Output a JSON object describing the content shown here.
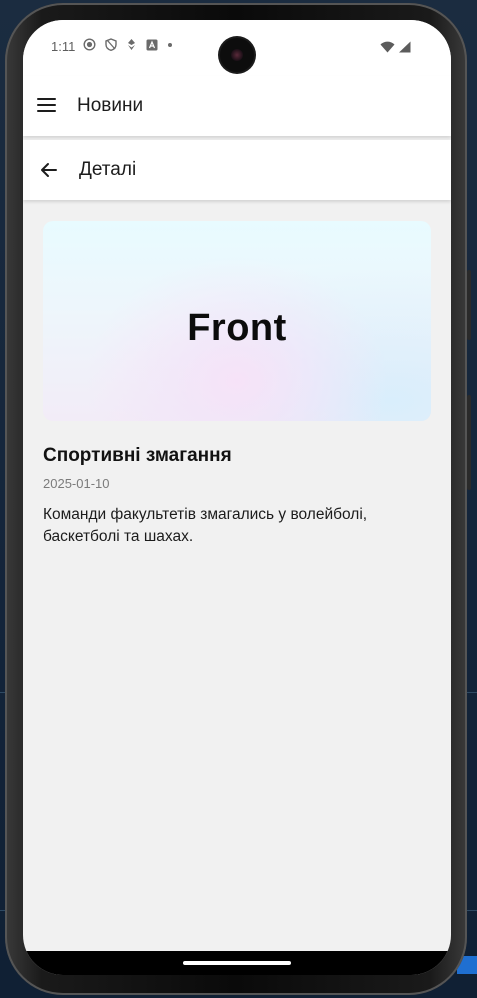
{
  "status_bar": {
    "time": "1:11",
    "icons": [
      "record-icon",
      "shield-icon",
      "vpn-icon",
      "text-icon",
      "dot-icon"
    ],
    "right_icons": [
      "wifi-icon",
      "signal-icon"
    ]
  },
  "app_bar": {
    "title": "Новини",
    "menu_icon": "menu-icon"
  },
  "detail_bar": {
    "title": "Деталі",
    "back_icon": "arrow-left-icon"
  },
  "article": {
    "image_text": "Front",
    "title": "Спортивні змагання",
    "date": "2025-01-10",
    "body": "Команди факультетів змагались у волейболі, баскетболі та шахах."
  },
  "colors": {
    "screen_background": "#f1f1f1",
    "app_bar_background": "#ffffff",
    "text_primary": "#1c1c1c",
    "text_secondary": "#7b7b7b"
  }
}
